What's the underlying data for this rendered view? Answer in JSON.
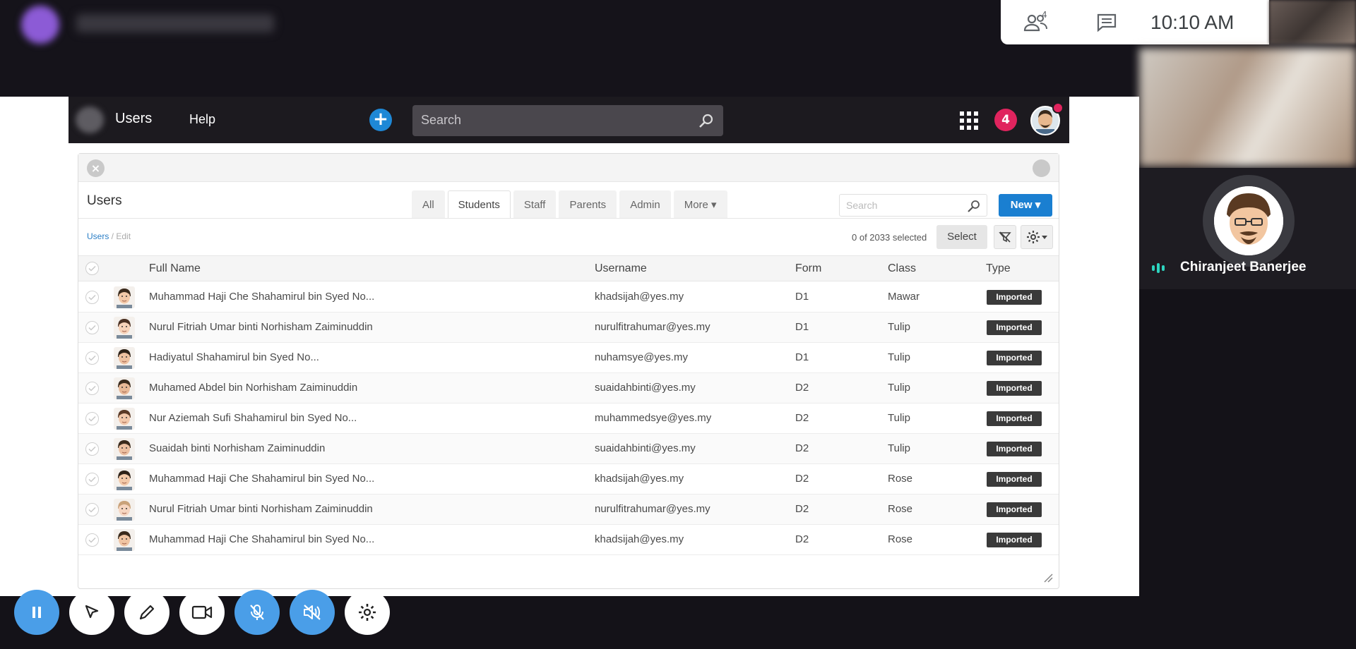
{
  "meeting": {
    "time": "10:10 AM",
    "people_count": "4",
    "participant_name": "Chiranjeet Banerjee"
  },
  "nav": {
    "users_label": "Users",
    "help_label": "Help",
    "search_placeholder": "Search",
    "notification_count": "4"
  },
  "panel": {
    "title": "Users",
    "tabs": [
      {
        "label": "All"
      },
      {
        "label": "Students"
      },
      {
        "label": "Staff"
      },
      {
        "label": "Parents"
      },
      {
        "label": "Admin"
      },
      {
        "label": "More ▾"
      }
    ],
    "active_tab": "Students",
    "search_placeholder": "Search",
    "new_label": "New ▾",
    "breadcrumb": {
      "root": "Users",
      "separator": " / ",
      "current": "Edit"
    },
    "selected_text": "0 of 2033 selected",
    "select_label": "Select"
  },
  "table": {
    "headers": {
      "full_name": "Full Name",
      "username": "Username",
      "form": "Form",
      "class": "Class",
      "type": "Type"
    },
    "rows": [
      {
        "name": "Muhammad Haji Che Shahamirul bin Syed No...",
        "username": "khadsijah@yes.my",
        "form": "D1",
        "class": "Mawar",
        "type": "Imported"
      },
      {
        "name": "Nurul Fitriah Umar binti Norhisham Zaiminuddin",
        "username": "nurulfitrahumar@yes.my",
        "form": "D1",
        "class": "Tulip",
        "type": "Imported"
      },
      {
        "name": "Hadiyatul Shahamirul bin Syed No...",
        "username": "nuhamsye@yes.my",
        "form": "D1",
        "class": "Tulip",
        "type": "Imported"
      },
      {
        "name": "Muhamed Abdel bin Norhisham Zaiminuddin",
        "username": "suaidahbinti@yes.my",
        "form": "D2",
        "class": "Tulip",
        "type": "Imported"
      },
      {
        "name": "Nur Aziemah Sufi Shahamirul bin Syed No...",
        "username": "muhammedsye@yes.my",
        "form": "D2",
        "class": "Tulip",
        "type": "Imported"
      },
      {
        "name": "Suaidah binti Norhisham Zaiminuddin",
        "username": "suaidahbinti@yes.my",
        "form": "D2",
        "class": "Tulip",
        "type": "Imported"
      },
      {
        "name": "Muhammad Haji Che Shahamirul bin Syed No...",
        "username": "khadsijah@yes.my",
        "form": "D2",
        "class": "Rose",
        "type": "Imported"
      },
      {
        "name": "Nurul Fitriah Umar binti Norhisham Zaiminuddin",
        "username": "nurulfitrahumar@yes.my",
        "form": "D2",
        "class": "Rose",
        "type": "Imported"
      },
      {
        "name": "Muhammad Haji Che Shahamirul bin Syed No...",
        "username": "khadsijah@yes.my",
        "form": "D2",
        "class": "Rose",
        "type": "Imported"
      }
    ]
  },
  "toolbar": {
    "items": [
      "pause-icon",
      "pointer-icon",
      "pen-icon",
      "camera-icon",
      "mic-off-icon",
      "speaker-off-icon",
      "gear-icon"
    ]
  },
  "colors": {
    "accent_blue": "#1a7fd1",
    "badge_red": "#e0245e",
    "badge_dark": "#3a3a3a",
    "toolbar_blue": "#4a9ee8"
  }
}
